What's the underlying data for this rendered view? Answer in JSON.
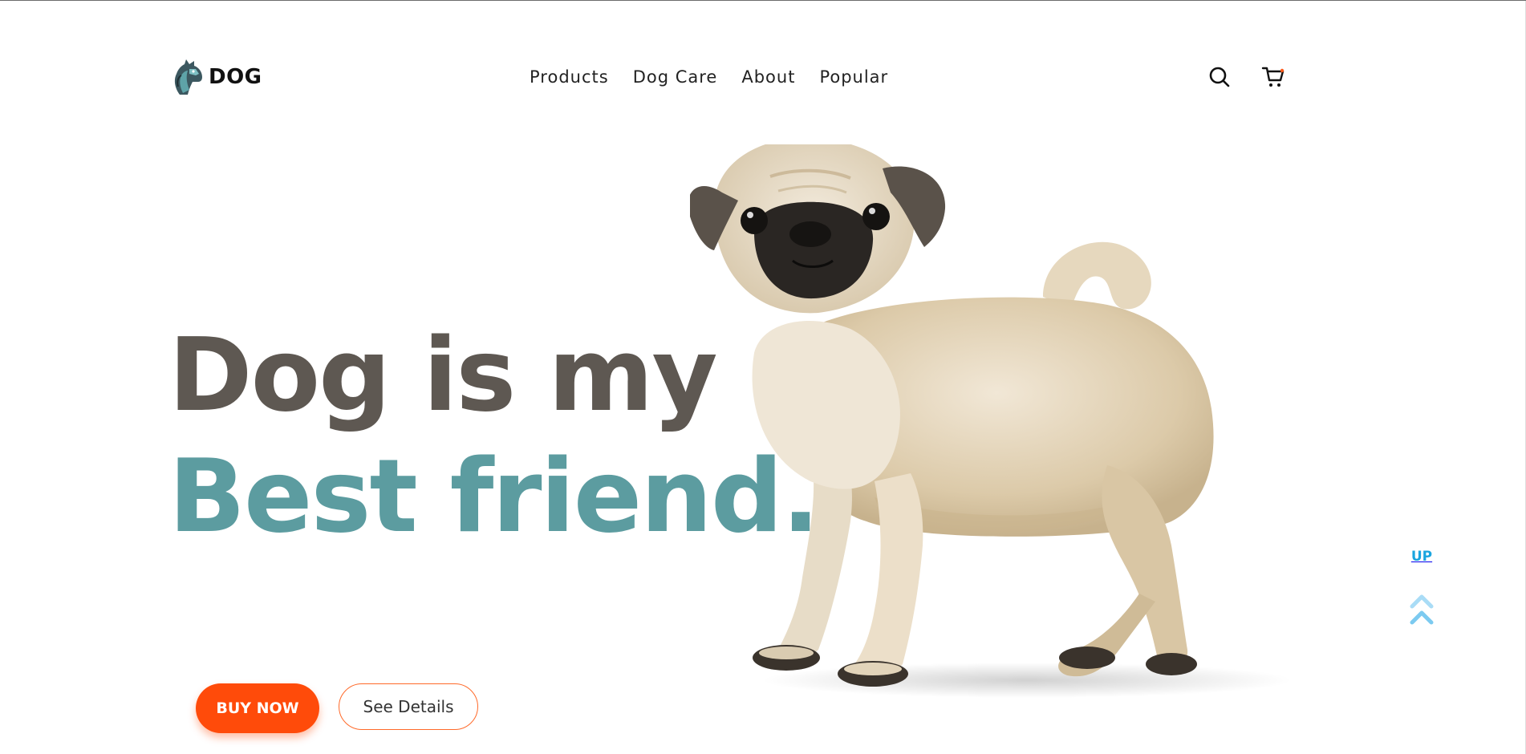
{
  "brand": {
    "name": "DOG",
    "logo_icon": "dog-head-icon"
  },
  "nav": {
    "items": [
      {
        "label": "Products"
      },
      {
        "label": "Dog Care"
      },
      {
        "label": "About"
      },
      {
        "label": "Popular"
      }
    ]
  },
  "header_icons": {
    "search": "search-icon",
    "cart": "cart-icon"
  },
  "hero": {
    "line1": "Dog is my",
    "line2": "Best friend.",
    "image": "pug-puppy-illustration"
  },
  "buttons": {
    "buy_now": "BUY NOW",
    "see_details": "See Details"
  },
  "scroll_up": {
    "label": "UP",
    "icon": "double-chevron-up-icon"
  },
  "colors": {
    "heading_dark": "#5e5852",
    "heading_teal": "#5c9ca0",
    "accent_orange": "#ff4b0a",
    "up_blue": "#1aa5df",
    "up_arrow_light": "#a9dcf6"
  }
}
